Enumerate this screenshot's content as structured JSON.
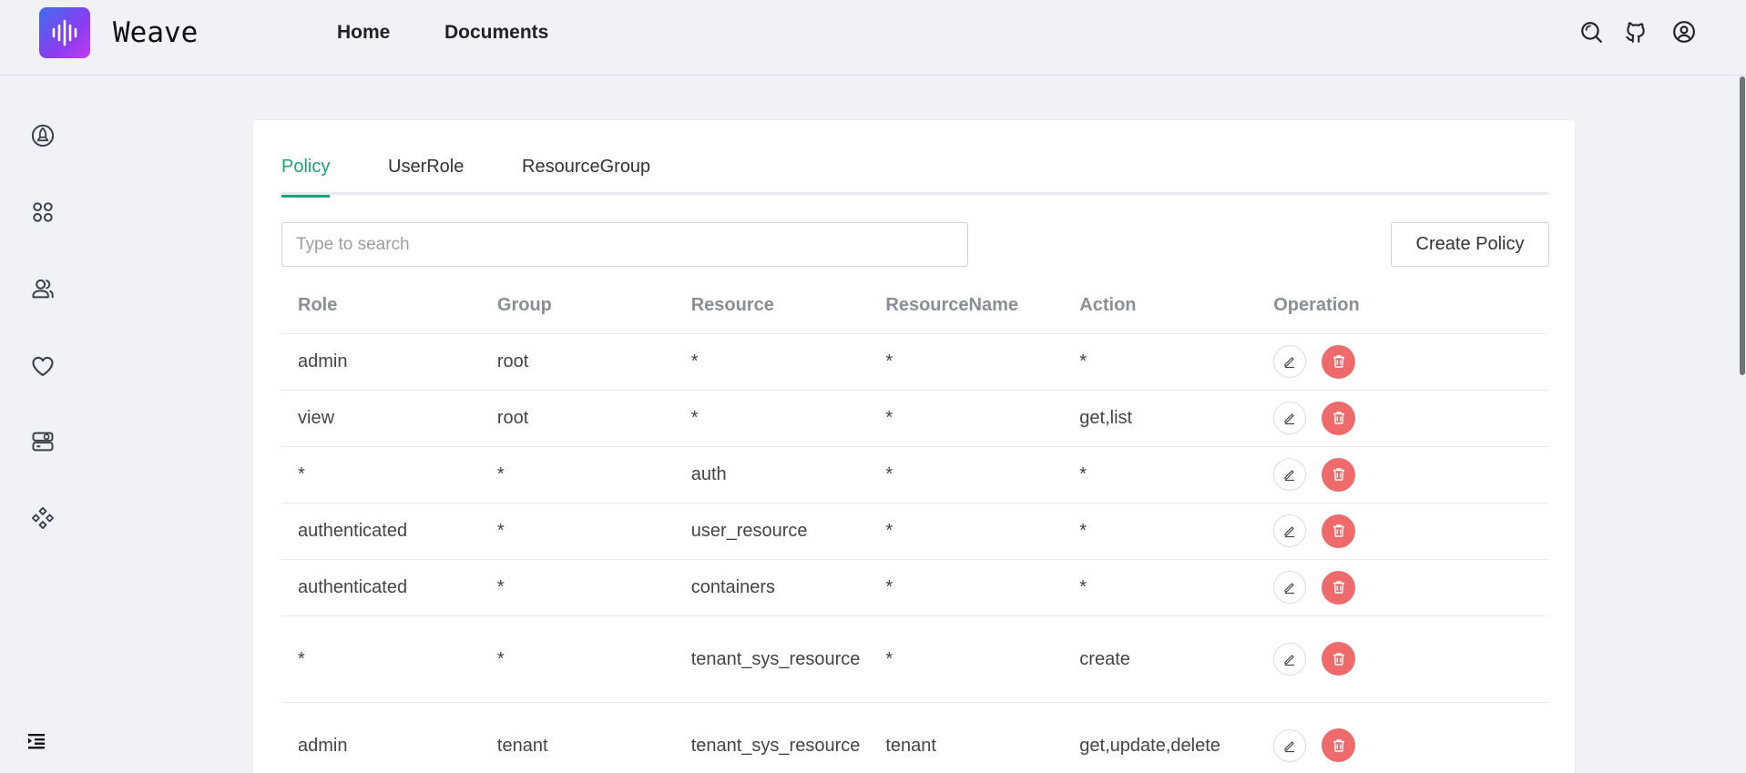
{
  "header": {
    "brand": "Weave",
    "nav": [
      {
        "label": "Home"
      },
      {
        "label": "Documents"
      }
    ],
    "icons": [
      "search-icon",
      "github-icon",
      "user-icon"
    ]
  },
  "sidebar": {
    "icons": [
      "rocket-icon",
      "apps-icon",
      "users-icon",
      "heart-icon",
      "server-settings-icon",
      "components-icon",
      "collapse-menu-icon"
    ]
  },
  "tabs": [
    {
      "label": "Policy",
      "active": true
    },
    {
      "label": "UserRole",
      "active": false
    },
    {
      "label": "ResourceGroup",
      "active": false
    }
  ],
  "search": {
    "placeholder": "Type to search",
    "value": ""
  },
  "create_button": "Create Policy",
  "table": {
    "columns": [
      "Role",
      "Group",
      "Resource",
      "ResourceName",
      "Action",
      "Operation"
    ],
    "rows": [
      [
        "admin",
        "root",
        "*",
        "*",
        "*"
      ],
      [
        "view",
        "root",
        "*",
        "*",
        "get,list"
      ],
      [
        "*",
        "*",
        "auth",
        "*",
        "*"
      ],
      [
        "authenticated",
        "*",
        "user_resource",
        "*",
        "*"
      ],
      [
        "authenticated",
        "*",
        "containers",
        "*",
        "*"
      ],
      [
        "*",
        "*",
        "tenant_sys_resource",
        "*",
        "create"
      ],
      [
        "admin",
        "tenant",
        "tenant_sys_resource",
        "tenant",
        "get,update,delete"
      ]
    ]
  },
  "colors": {
    "accent": "#1aa37a",
    "danger": "#ef6b6b",
    "background": "#f0f2f7"
  }
}
